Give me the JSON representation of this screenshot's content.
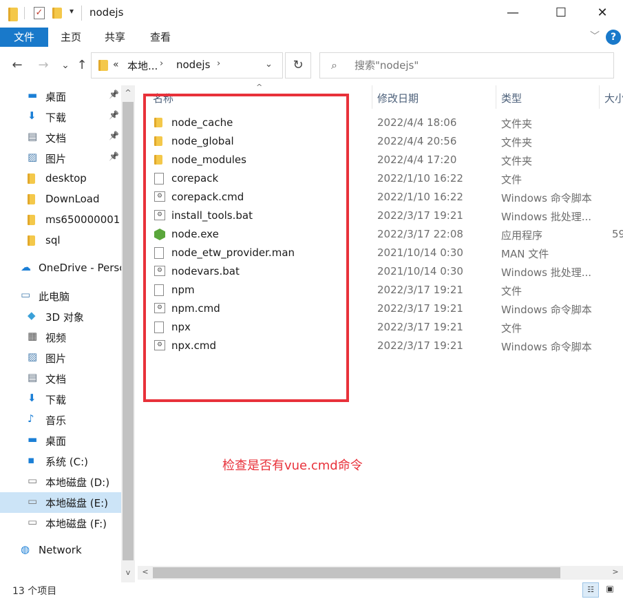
{
  "window": {
    "title": "nodejs",
    "quick_access_dropdown": "▾",
    "minimize": "—",
    "maximize": "☐",
    "close": "✕"
  },
  "ribbon": {
    "tabs": [
      "文件",
      "主页",
      "共享",
      "查看"
    ],
    "expand": "﹀",
    "help": "?"
  },
  "nav": {
    "back": "←",
    "forward": "→",
    "recent": "⌄",
    "up": "↑",
    "address_prefix": "«",
    "address_segments": [
      "本地...",
      "nodejs"
    ],
    "address_sep": "›",
    "address_dropdown": "⌄",
    "refresh": "↻",
    "search_placeholder": "搜索\"nodejs\""
  },
  "sidebar": {
    "items": [
      {
        "label": "桌面",
        "icon": "desktop-icon",
        "pinned": true
      },
      {
        "label": "下载",
        "icon": "download-icon",
        "pinned": true
      },
      {
        "label": "文档",
        "icon": "document-icon",
        "pinned": true
      },
      {
        "label": "图片",
        "icon": "picture-icon",
        "pinned": true
      },
      {
        "label": "desktop",
        "icon": "folder-icon",
        "pinned": false
      },
      {
        "label": "DownLoad",
        "icon": "folder-icon",
        "pinned": false
      },
      {
        "label": "ms650000001",
        "icon": "folder-icon",
        "pinned": false
      },
      {
        "label": "sql",
        "icon": "folder-icon",
        "pinned": false
      },
      {
        "label": "OneDrive - Persc",
        "icon": "cloud-icon",
        "pinned": false
      },
      {
        "label": "此电脑",
        "icon": "computer-icon",
        "pinned": false
      },
      {
        "label": "3D 对象",
        "icon": "cube-icon",
        "pinned": false
      },
      {
        "label": "视频",
        "icon": "video-icon",
        "pinned": false
      },
      {
        "label": "图片",
        "icon": "picture-icon",
        "pinned": false
      },
      {
        "label": "文档",
        "icon": "document-icon",
        "pinned": false
      },
      {
        "label": "下载",
        "icon": "download-icon",
        "pinned": false
      },
      {
        "label": "音乐",
        "icon": "music-icon",
        "pinned": false
      },
      {
        "label": "桌面",
        "icon": "desktop-icon",
        "pinned": false
      },
      {
        "label": "系统 (C:)",
        "icon": "windows-drive-icon",
        "pinned": false
      },
      {
        "label": "本地磁盘 (D:)",
        "icon": "drive-icon",
        "pinned": false
      },
      {
        "label": "本地磁盘 (E:)",
        "icon": "drive-icon",
        "pinned": false,
        "selected": true
      },
      {
        "label": "本地磁盘 (F:)",
        "icon": "drive-icon",
        "pinned": false
      },
      {
        "label": "Network",
        "icon": "network-icon",
        "pinned": false
      }
    ],
    "pin_glyph": "📌"
  },
  "columns": {
    "name": "名称",
    "date": "修改日期",
    "type": "类型",
    "size": "大小",
    "sort_glyph": "^"
  },
  "files": [
    {
      "name": "node_cache",
      "date": "2022/4/4 18:06",
      "type": "文件夹",
      "size": "",
      "icon": "folder-icon"
    },
    {
      "name": "node_global",
      "date": "2022/4/4 20:56",
      "type": "文件夹",
      "size": "",
      "icon": "folder-icon"
    },
    {
      "name": "node_modules",
      "date": "2022/4/4 17:20",
      "type": "文件夹",
      "size": "",
      "icon": "folder-icon"
    },
    {
      "name": "corepack",
      "date": "2022/1/10 16:22",
      "type": "文件",
      "size": "",
      "icon": "file-icon"
    },
    {
      "name": "corepack.cmd",
      "date": "2022/1/10 16:22",
      "type": "Windows 命令脚本",
      "size": "",
      "icon": "script-icon"
    },
    {
      "name": "install_tools.bat",
      "date": "2022/3/17 19:21",
      "type": "Windows 批处理...",
      "size": "",
      "icon": "script-icon"
    },
    {
      "name": "node.exe",
      "date": "2022/3/17 22:08",
      "type": "应用程序",
      "size": "59",
      "icon": "node-exe-icon"
    },
    {
      "name": "node_etw_provider.man",
      "date": "2021/10/14 0:30",
      "type": "MAN 文件",
      "size": "",
      "icon": "file-icon"
    },
    {
      "name": "nodevars.bat",
      "date": "2021/10/14 0:30",
      "type": "Windows 批处理...",
      "size": "",
      "icon": "script-icon"
    },
    {
      "name": "npm",
      "date": "2022/3/17 19:21",
      "type": "文件",
      "size": "",
      "icon": "file-icon"
    },
    {
      "name": "npm.cmd",
      "date": "2022/3/17 19:21",
      "type": "Windows 命令脚本",
      "size": "",
      "icon": "script-icon"
    },
    {
      "name": "npx",
      "date": "2022/3/17 19:21",
      "type": "文件",
      "size": "",
      "icon": "file-icon"
    },
    {
      "name": "npx.cmd",
      "date": "2022/3/17 19:21",
      "type": "Windows 命令脚本",
      "size": "",
      "icon": "script-icon"
    }
  ],
  "annotation": {
    "text": "检查是否有vue.cmd命令",
    "color": "#e8313a"
  },
  "scroll": {
    "up": "^",
    "down": "v",
    "left": "<",
    "right": ">"
  },
  "status": {
    "item_count": "13 个项目",
    "details_view_glyph": "☷",
    "tiles_view_glyph": "▣"
  },
  "colors": {
    "accent": "#1979ca",
    "selection": "#cce4f7",
    "folder": "#f4c84a"
  }
}
